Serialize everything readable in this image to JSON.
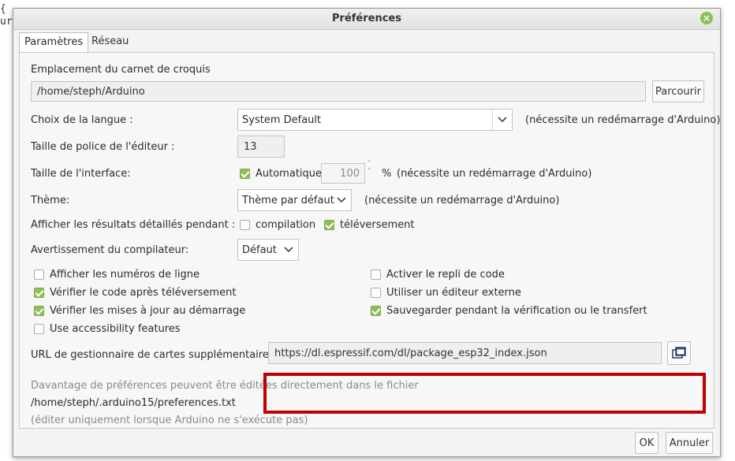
{
  "background": {
    "line1": "{",
    "line2": "ur"
  },
  "window": {
    "title": "Préférences"
  },
  "tabs": [
    {
      "label": "Paramètres"
    },
    {
      "label": "Réseau"
    }
  ],
  "sketchbook": {
    "label": "Emplacement du carnet de croquis",
    "path": "/home/steph/Arduino",
    "browse_label": "Parcourir"
  },
  "language": {
    "label": "Choix de la langue :",
    "value": "System Default",
    "note": "(nécessite un redémarrage d'Arduino)"
  },
  "font_size": {
    "label": "Taille de police de l'éditeur :",
    "value": "13"
  },
  "interface_scale": {
    "label": "Taille de l'interface:",
    "auto_label": "Automatique",
    "auto_checked": true,
    "value": "100",
    "unit": "%",
    "note": "(nécessite un redémarrage d'Arduino)"
  },
  "theme": {
    "label": "Thème:",
    "value": "Thème par défaut",
    "note": "(nécessite un redémarrage d'Arduino)"
  },
  "verbose": {
    "label": "Afficher les résultats détaillés pendant :",
    "compile_label": "compilation",
    "compile_checked": false,
    "upload_label": "téléversement",
    "upload_checked": true
  },
  "warnings": {
    "label": "Avertissement du compilateur:",
    "value": "Défaut"
  },
  "options_left": [
    {
      "label": "Afficher les numéros de ligne",
      "checked": false
    },
    {
      "label": "Vérifier le code après téléversement",
      "checked": true
    },
    {
      "label": "Vérifier les mises à jour au démarrage",
      "checked": true
    },
    {
      "label": "Use accessibility features",
      "checked": false
    }
  ],
  "options_right": [
    {
      "label": "Activer le repli de code",
      "checked": false
    },
    {
      "label": "Utiliser un éditeur externe",
      "checked": false
    },
    {
      "label": "Sauvegarder pendant la vérification ou le transfert",
      "checked": true
    }
  ],
  "boards_url": {
    "label": "URL de gestionnaire de cartes supplémentaires",
    "value": "https://dl.espressif.com/dl/package_esp32_index.json"
  },
  "footer": {
    "more_prefs": "Davantage de préférences peuvent être éditées directement dans le fichier",
    "prefs_path": "/home/steph/.arduino15/preferences.txt",
    "edit_note": "(éditer uniquement lorsque Arduino ne s'exécute pas)"
  },
  "buttons": {
    "ok": "OK",
    "cancel": "Annuler"
  },
  "colors": {
    "highlight": "#c00000",
    "check": "#8fbf56",
    "close": "#8cc152"
  }
}
